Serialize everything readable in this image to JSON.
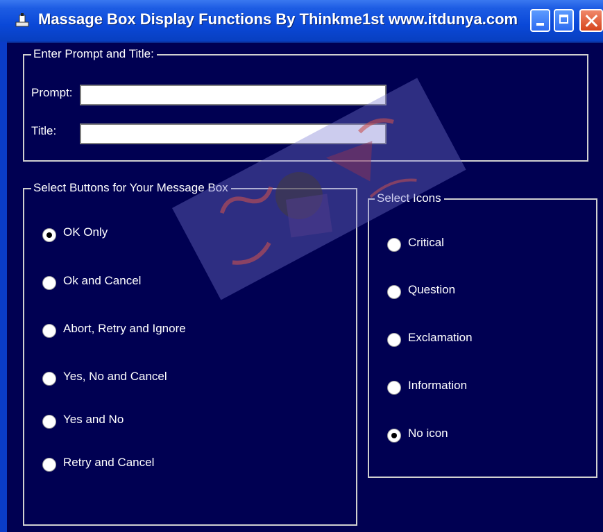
{
  "window": {
    "title": "Massage Box Display Functions  By Thinkme1st www.itdunya.com",
    "title_icon": "vb-app-icon",
    "controls": [
      "minimize",
      "maximize",
      "close"
    ],
    "accent": "#0a48d8",
    "background": "#000052"
  },
  "prompt_group": {
    "legend": "Enter Prompt and Title:",
    "prompt_label": "Prompt:",
    "prompt_value": "",
    "title_label": "Title:",
    "title_value": ""
  },
  "buttons_group": {
    "legend": "Select Buttons for Your Message Box",
    "options": [
      {
        "label": "OK Only",
        "checked": true
      },
      {
        "label": "Ok and Cancel",
        "checked": false
      },
      {
        "label": "Abort, Retry and Ignore",
        "checked": false
      },
      {
        "label": "Yes, No and Cancel",
        "checked": false
      },
      {
        "label": "Yes and No",
        "checked": false
      },
      {
        "label": "Retry and Cancel",
        "checked": false
      }
    ]
  },
  "icons_group": {
    "legend": "Select Icons",
    "options": [
      {
        "label": "Critical",
        "checked": false
      },
      {
        "label": "Question",
        "checked": false
      },
      {
        "label": "Exclamation",
        "checked": false
      },
      {
        "label": "Information",
        "checked": false
      },
      {
        "label": "No icon",
        "checked": true
      }
    ]
  }
}
